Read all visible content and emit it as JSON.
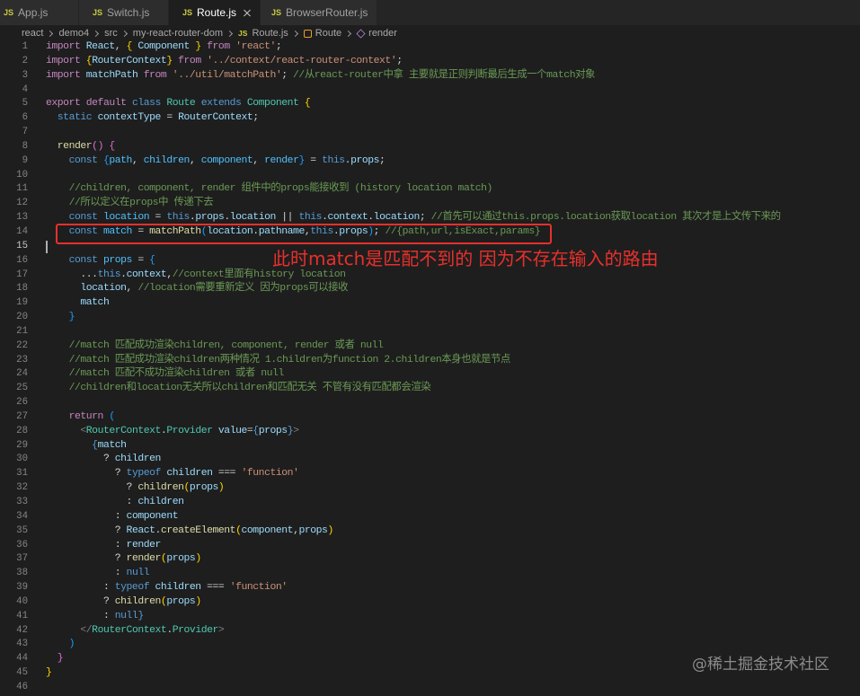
{
  "colors": {
    "editor_bg": "#1e1e1e",
    "tabbar_bg": "#252526",
    "tab_inactive_bg": "#2d2d2d",
    "tab_active_bg": "#1e1e1e",
    "tab_inactive_text": "#a0a0a0",
    "tab_active_text": "#ffffff",
    "js_badge": "#cbcb41",
    "breadcrumb_text": "#a9a9a9",
    "line_number": "#858585",
    "line_number_active": "#c6c6c6",
    "annotation_red": "#e8302c",
    "watermark": "#8c8c8c"
  },
  "tabs": [
    {
      "badge": "JS",
      "label": "App.js",
      "active": false
    },
    {
      "badge": "JS",
      "label": "Switch.js",
      "active": false
    },
    {
      "badge": "JS",
      "label": "Route.js",
      "active": true,
      "close_icon": "close-icon"
    },
    {
      "badge": "JS",
      "label": "BrowserRouter.js",
      "active": false
    }
  ],
  "breadcrumb": {
    "separator_icon": "chevron-right-icon",
    "items": [
      {
        "label": "react"
      },
      {
        "label": "demo4"
      },
      {
        "label": "src"
      },
      {
        "label": "my-react-router-dom"
      },
      {
        "badge": "JS",
        "label": "Route.js"
      },
      {
        "icon": "symbol-class-icon",
        "label": "Route"
      },
      {
        "icon": "symbol-method-icon",
        "label": "render"
      }
    ]
  },
  "code": {
    "cursor_line": 15,
    "lines": [
      {
        "n": 1,
        "t": [
          [
            "import ",
            "#c586c0"
          ],
          [
            "React",
            "#9cdcfe"
          ],
          [
            ", ",
            "#d4d4d4"
          ],
          [
            "{",
            "#ffd700"
          ],
          [
            " Component ",
            "#9cdcfe"
          ],
          [
            "}",
            "#ffd700"
          ],
          [
            " from ",
            "#c586c0"
          ],
          [
            "'react'",
            "#ce9178"
          ],
          [
            ";",
            "#d4d4d4"
          ]
        ]
      },
      {
        "n": 2,
        "t": [
          [
            "import ",
            "#c586c0"
          ],
          [
            "{",
            "#ffd700"
          ],
          [
            "RouterContext",
            "#9cdcfe"
          ],
          [
            "}",
            "#ffd700"
          ],
          [
            " from ",
            "#c586c0"
          ],
          [
            "'../context/react-router-context'",
            "#ce9178"
          ],
          [
            ";",
            "#d4d4d4"
          ]
        ]
      },
      {
        "n": 3,
        "t": [
          [
            "import ",
            "#c586c0"
          ],
          [
            "matchPath",
            "#9cdcfe"
          ],
          [
            " from ",
            "#c586c0"
          ],
          [
            "'../util/matchPath'",
            "#ce9178"
          ],
          [
            "; ",
            "#d4d4d4"
          ],
          [
            "//从react-router中拿 主要就是正则判断最后生成一个match对象",
            "#6a9955"
          ]
        ]
      },
      {
        "n": 4,
        "t": []
      },
      {
        "n": 5,
        "t": [
          [
            "export default ",
            "#c586c0"
          ],
          [
            "class ",
            "#569cd6"
          ],
          [
            "Route ",
            "#4ec9b0"
          ],
          [
            "extends ",
            "#569cd6"
          ],
          [
            "Component ",
            "#4ec9b0"
          ],
          [
            "{",
            "#ffd700"
          ]
        ]
      },
      {
        "n": 6,
        "t": [
          [
            "  static ",
            "#569cd6"
          ],
          [
            "contextType",
            "#9cdcfe"
          ],
          [
            " = ",
            "#d4d4d4"
          ],
          [
            "RouterContext",
            "#9cdcfe"
          ],
          [
            ";",
            "#d4d4d4"
          ]
        ]
      },
      {
        "n": 7,
        "t": []
      },
      {
        "n": 8,
        "t": [
          [
            "  render",
            "#dcdcaa"
          ],
          [
            "()",
            "#da70d6"
          ],
          [
            " ",
            "#d4d4d4"
          ],
          [
            "{",
            "#da70d6"
          ]
        ]
      },
      {
        "n": 9,
        "t": [
          [
            "    const ",
            "#569cd6"
          ],
          [
            "{",
            "#179fff"
          ],
          [
            "path",
            "#4fc1ff"
          ],
          [
            ", ",
            "#d4d4d4"
          ],
          [
            "children",
            "#4fc1ff"
          ],
          [
            ", ",
            "#d4d4d4"
          ],
          [
            "component",
            "#4fc1ff"
          ],
          [
            ", ",
            "#d4d4d4"
          ],
          [
            "render",
            "#4fc1ff"
          ],
          [
            "}",
            "#179fff"
          ],
          [
            " = ",
            "#d4d4d4"
          ],
          [
            "this",
            "#569cd6"
          ],
          [
            ".",
            "#d4d4d4"
          ],
          [
            "props",
            "#9cdcfe"
          ],
          [
            ";",
            "#d4d4d4"
          ]
        ]
      },
      {
        "n": 10,
        "t": []
      },
      {
        "n": 11,
        "t": [
          [
            "    //children, component, render 组件中的props能接收到 (history location match)",
            "#6a9955"
          ]
        ]
      },
      {
        "n": 12,
        "t": [
          [
            "    //所以定义在props中 传递下去",
            "#6a9955"
          ]
        ]
      },
      {
        "n": 13,
        "t": [
          [
            "    const ",
            "#569cd6"
          ],
          [
            "location",
            "#4fc1ff"
          ],
          [
            " = ",
            "#d4d4d4"
          ],
          [
            "this",
            "#569cd6"
          ],
          [
            ".",
            "#d4d4d4"
          ],
          [
            "props",
            "#9cdcfe"
          ],
          [
            ".",
            "#d4d4d4"
          ],
          [
            "location",
            "#9cdcfe"
          ],
          [
            " || ",
            "#d4d4d4"
          ],
          [
            "this",
            "#569cd6"
          ],
          [
            ".",
            "#d4d4d4"
          ],
          [
            "context",
            "#9cdcfe"
          ],
          [
            ".",
            "#d4d4d4"
          ],
          [
            "location",
            "#9cdcfe"
          ],
          [
            "; ",
            "#d4d4d4"
          ],
          [
            "//首先可以通过this.props.location获取location 其次才是上文传下来的",
            "#6a9955"
          ]
        ]
      },
      {
        "n": 14,
        "t": [
          [
            "    const ",
            "#569cd6"
          ],
          [
            "match",
            "#4fc1ff"
          ],
          [
            " = ",
            "#d4d4d4"
          ],
          [
            "matchPath",
            "#dcdcaa"
          ],
          [
            "(",
            "#179fff"
          ],
          [
            "location",
            "#9cdcfe"
          ],
          [
            ".",
            "#d4d4d4"
          ],
          [
            "pathname",
            "#9cdcfe"
          ],
          [
            ",",
            "#d4d4d4"
          ],
          [
            "this",
            "#569cd6"
          ],
          [
            ".",
            "#d4d4d4"
          ],
          [
            "props",
            "#9cdcfe"
          ],
          [
            ")",
            "#179fff"
          ],
          [
            "; ",
            "#d4d4d4"
          ],
          [
            "//{path,url,isExact,params}",
            "#6a9955"
          ]
        ]
      },
      {
        "n": 15,
        "t": []
      },
      {
        "n": 16,
        "t": [
          [
            "    const ",
            "#569cd6"
          ],
          [
            "props",
            "#4fc1ff"
          ],
          [
            " = ",
            "#d4d4d4"
          ],
          [
            "{",
            "#179fff"
          ]
        ]
      },
      {
        "n": 17,
        "t": [
          [
            "      ...",
            "#d4d4d4"
          ],
          [
            "this",
            "#569cd6"
          ],
          [
            ".",
            "#d4d4d4"
          ],
          [
            "context",
            "#9cdcfe"
          ],
          [
            ",",
            "#d4d4d4"
          ],
          [
            "//context里面有history location",
            "#6a9955"
          ]
        ]
      },
      {
        "n": 18,
        "t": [
          [
            "      location",
            "#9cdcfe"
          ],
          [
            ", ",
            "#d4d4d4"
          ],
          [
            "//location需要重新定义 因为props可以接收",
            "#6a9955"
          ]
        ]
      },
      {
        "n": 19,
        "t": [
          [
            "      match",
            "#9cdcfe"
          ]
        ]
      },
      {
        "n": 20,
        "t": [
          [
            "    }",
            "#179fff"
          ]
        ]
      },
      {
        "n": 21,
        "t": []
      },
      {
        "n": 22,
        "t": [
          [
            "    //match 匹配成功渲染children, component, render 或者 null",
            "#6a9955"
          ]
        ]
      },
      {
        "n": 23,
        "t": [
          [
            "    //match 匹配成功渲染children两种情况 1.children为function 2.children本身也就是节点",
            "#6a9955"
          ]
        ]
      },
      {
        "n": 24,
        "t": [
          [
            "    //match 匹配不成功渲染children 或者 null",
            "#6a9955"
          ]
        ]
      },
      {
        "n": 25,
        "t": [
          [
            "    //children和location无关所以children和匹配无关 不管有没有匹配都会渲染",
            "#6a9955"
          ]
        ]
      },
      {
        "n": 26,
        "t": []
      },
      {
        "n": 27,
        "t": [
          [
            "    return ",
            "#c586c0"
          ],
          [
            "(",
            "#179fff"
          ]
        ]
      },
      {
        "n": 28,
        "t": [
          [
            "      <",
            "#808080"
          ],
          [
            "RouterContext",
            "#4ec9b0"
          ],
          [
            ".",
            "#d4d4d4"
          ],
          [
            "Provider",
            "#4ec9b0"
          ],
          [
            " value",
            "#9cdcfe"
          ],
          [
            "=",
            "#d4d4d4"
          ],
          [
            "{",
            "#569cd6"
          ],
          [
            "props",
            "#9cdcfe"
          ],
          [
            "}",
            "#569cd6"
          ],
          [
            ">",
            "#808080"
          ]
        ]
      },
      {
        "n": 29,
        "t": [
          [
            "        {",
            "#569cd6"
          ],
          [
            "match",
            "#9cdcfe"
          ]
        ]
      },
      {
        "n": 30,
        "t": [
          [
            "          ? ",
            "#d4d4d4"
          ],
          [
            "children",
            "#9cdcfe"
          ]
        ]
      },
      {
        "n": 31,
        "t": [
          [
            "            ? ",
            "#d4d4d4"
          ],
          [
            "typeof ",
            "#569cd6"
          ],
          [
            "children",
            "#9cdcfe"
          ],
          [
            " === ",
            "#d4d4d4"
          ],
          [
            "'function'",
            "#ce9178"
          ]
        ]
      },
      {
        "n": 32,
        "t": [
          [
            "              ? ",
            "#d4d4d4"
          ],
          [
            "children",
            "#dcdcaa"
          ],
          [
            "(",
            "#ffd700"
          ],
          [
            "props",
            "#9cdcfe"
          ],
          [
            ")",
            "#ffd700"
          ]
        ]
      },
      {
        "n": 33,
        "t": [
          [
            "              : ",
            "#d4d4d4"
          ],
          [
            "children",
            "#9cdcfe"
          ]
        ]
      },
      {
        "n": 34,
        "t": [
          [
            "            : ",
            "#d4d4d4"
          ],
          [
            "component",
            "#9cdcfe"
          ]
        ]
      },
      {
        "n": 35,
        "t": [
          [
            "            ? ",
            "#d4d4d4"
          ],
          [
            "React",
            "#9cdcfe"
          ],
          [
            ".",
            "#d4d4d4"
          ],
          [
            "createElement",
            "#dcdcaa"
          ],
          [
            "(",
            "#ffd700"
          ],
          [
            "component",
            "#9cdcfe"
          ],
          [
            ",",
            "#d4d4d4"
          ],
          [
            "props",
            "#9cdcfe"
          ],
          [
            ")",
            "#ffd700"
          ]
        ]
      },
      {
        "n": 36,
        "t": [
          [
            "            : ",
            "#d4d4d4"
          ],
          [
            "render",
            "#9cdcfe"
          ]
        ]
      },
      {
        "n": 37,
        "t": [
          [
            "            ? ",
            "#d4d4d4"
          ],
          [
            "render",
            "#dcdcaa"
          ],
          [
            "(",
            "#ffd700"
          ],
          [
            "props",
            "#9cdcfe"
          ],
          [
            ")",
            "#ffd700"
          ]
        ]
      },
      {
        "n": 38,
        "t": [
          [
            "            : ",
            "#d4d4d4"
          ],
          [
            "null",
            "#569cd6"
          ]
        ]
      },
      {
        "n": 39,
        "t": [
          [
            "          : ",
            "#d4d4d4"
          ],
          [
            "typeof ",
            "#569cd6"
          ],
          [
            "children",
            "#9cdcfe"
          ],
          [
            " === ",
            "#d4d4d4"
          ],
          [
            "'function'",
            "#ce9178"
          ]
        ]
      },
      {
        "n": 40,
        "t": [
          [
            "          ? ",
            "#d4d4d4"
          ],
          [
            "children",
            "#dcdcaa"
          ],
          [
            "(",
            "#ffd700"
          ],
          [
            "props",
            "#9cdcfe"
          ],
          [
            ")",
            "#ffd700"
          ]
        ]
      },
      {
        "n": 41,
        "t": [
          [
            "          : ",
            "#d4d4d4"
          ],
          [
            "null",
            "#569cd6"
          ],
          [
            "}",
            "#569cd6"
          ]
        ]
      },
      {
        "n": 42,
        "t": [
          [
            "      </",
            "#808080"
          ],
          [
            "RouterContext",
            "#4ec9b0"
          ],
          [
            ".",
            "#d4d4d4"
          ],
          [
            "Provider",
            "#4ec9b0"
          ],
          [
            ">",
            "#808080"
          ]
        ]
      },
      {
        "n": 43,
        "t": [
          [
            "    )",
            "#179fff"
          ]
        ]
      },
      {
        "n": 44,
        "t": [
          [
            "  }",
            "#da70d6"
          ]
        ]
      },
      {
        "n": 45,
        "t": [
          [
            "}",
            "#ffd700"
          ]
        ]
      },
      {
        "n": 46,
        "t": []
      }
    ]
  },
  "annotation": {
    "text": "此时match是匹配不到的 因为不存在输入的路由"
  },
  "watermark": "@稀土掘金技术社区"
}
